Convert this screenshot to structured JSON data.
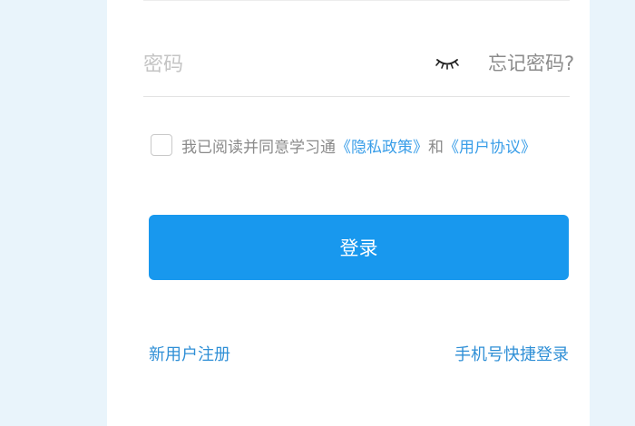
{
  "login_form": {
    "password_field": {
      "placeholder": "密码",
      "value": ""
    },
    "eye_toggle_icon": "eye-closed-icon",
    "forgot_password_label": "忘记密码?",
    "agreement": {
      "checked": false,
      "prefix_text": "我已阅读并同意学习通",
      "privacy_link": "《隐私政策》",
      "conjunction": "和",
      "terms_link": "《用户协议》"
    },
    "login_button_label": "登录",
    "register_link_label": "新用户注册",
    "phone_login_link_label": "手机号快捷登录"
  },
  "colors": {
    "accent": "#1898ee",
    "link": "#3a9ee8",
    "background": "#e9f4fb",
    "muted_text": "#8a8a8a"
  }
}
